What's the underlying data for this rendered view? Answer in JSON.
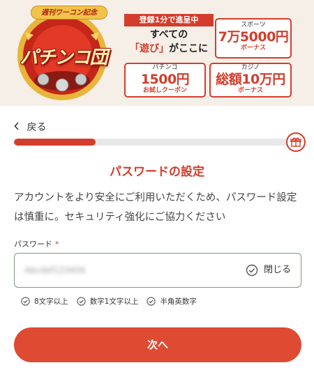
{
  "banner": {
    "logo_tagline": "週刊ワーコン記念",
    "logo_name": "パチンコ団",
    "promo_head": "登録1分で進呈中",
    "promo_line1": "すべての",
    "promo_line2_highlight": "「遊び」",
    "promo_line2_rest": "がここに",
    "sports": {
      "label": "スポーツ",
      "amount": "7万5000円",
      "sub": "ボーナス"
    },
    "pachinko": {
      "label": "パチンコ",
      "amount": "1500円",
      "sub": "お試しクーポン"
    },
    "casino": {
      "label": "カジノ",
      "amount": "総額10万円",
      "sub": "ボーナス"
    }
  },
  "nav": {
    "back_label": "戻る"
  },
  "progress": {
    "fraction": 0.29
  },
  "form": {
    "title": "パスワードの設定",
    "description": "アカウントをより安全にご利用いただくため、パスワード設定は慎重に。セキュリティ強化にご協力ください",
    "password_label": "パスワード",
    "required_mark": "*",
    "password_value": "Abcdef123456",
    "toggle_label": "閉じる",
    "rules": [
      "8文字以上",
      "数字1文字以上",
      "半角英数字"
    ],
    "next_label": "次へ"
  },
  "colors": {
    "accent": "#d43d2b",
    "button": "#de4a32",
    "field_border": "#7a9a7a"
  },
  "icons": [
    "chevron-left-icon",
    "gift-icon",
    "check-circle-icon"
  ]
}
